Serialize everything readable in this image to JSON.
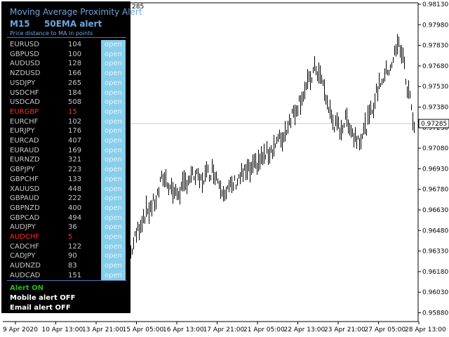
{
  "panel": {
    "title": "Moving Average Proximity Alert",
    "timeframe": "M15",
    "ma_label": "50EMA alert",
    "caption": "Price distance to MA in points",
    "rows": [
      {
        "symbol": "EURUSD",
        "distance": "104",
        "button": "open",
        "alert": false
      },
      {
        "symbol": "GBPUSD",
        "distance": "100",
        "button": "open",
        "alert": false
      },
      {
        "symbol": "AUDUSD",
        "distance": "128",
        "button": "open",
        "alert": false
      },
      {
        "symbol": "NZDUSD",
        "distance": "166",
        "button": "open",
        "alert": false
      },
      {
        "symbol": "USDJPY",
        "distance": "265",
        "button": "open",
        "alert": false
      },
      {
        "symbol": "USDCHF",
        "distance": "184",
        "button": "open",
        "alert": false
      },
      {
        "symbol": "USDCAD",
        "distance": "508",
        "button": "open",
        "alert": false
      },
      {
        "symbol": "EURGBP",
        "distance": "15",
        "button": "open",
        "alert": true
      },
      {
        "symbol": "EURCHF",
        "distance": "102",
        "button": "open",
        "alert": false
      },
      {
        "symbol": "EURJPY",
        "distance": "176",
        "button": "open",
        "alert": false
      },
      {
        "symbol": "EURCAD",
        "distance": "407",
        "button": "open",
        "alert": false
      },
      {
        "symbol": "EURAUD",
        "distance": "169",
        "button": "open",
        "alert": false
      },
      {
        "symbol": "EURNZD",
        "distance": "321",
        "button": "open",
        "alert": false
      },
      {
        "symbol": "GBPJPY",
        "distance": "223",
        "button": "open",
        "alert": false
      },
      {
        "symbol": "GBPCHF",
        "distance": "133",
        "button": "open",
        "alert": false
      },
      {
        "symbol": "XAUUSD",
        "distance": "448",
        "button": "open",
        "alert": false
      },
      {
        "symbol": "GBPAUD",
        "distance": "222",
        "button": "open",
        "alert": false
      },
      {
        "symbol": "GBPNZD",
        "distance": "400",
        "button": "open",
        "alert": false
      },
      {
        "symbol": "GBPCAD",
        "distance": "494",
        "button": "open",
        "alert": false
      },
      {
        "symbol": "AUDJPY",
        "distance": "36",
        "button": "open",
        "alert": false
      },
      {
        "symbol": "AUDCHF",
        "distance": "5",
        "button": "open",
        "alert": true
      },
      {
        "symbol": "CADCHF",
        "distance": "122",
        "button": "open",
        "alert": false
      },
      {
        "symbol": "CADJPY",
        "distance": "90",
        "button": "open",
        "alert": false
      },
      {
        "symbol": "AUDNZD",
        "distance": "83",
        "button": "open",
        "alert": false
      },
      {
        "symbol": "AUDCAD",
        "distance": "151",
        "button": "open",
        "alert": false
      }
    ],
    "alert_status": "Alert ON",
    "mobile_status": "Mobile alert OFF",
    "email_status": "Email alert OFF",
    "colors": {
      "alert_on": "#22bb22",
      "alert_row": "#ff2a2a",
      "button": "#87ceeb",
      "header": "#6ea6e0"
    }
  },
  "chart": {
    "top_left_value": "285",
    "current_price": "0.97285",
    "y_ticks": [
      "0.98130",
      "0.97980",
      "0.97830",
      "0.97680",
      "0.97530",
      "0.97380",
      "0.97230",
      "0.97080",
      "0.96930",
      "0.96780",
      "0.96630",
      "0.96480",
      "0.96330",
      "0.96180",
      "0.96030",
      "0.95880"
    ],
    "x_ticks": [
      "9 Apr 2020",
      "10 Apr 13:00",
      "13 Apr 21:00",
      "15 Apr 05:00",
      "16 Apr 13:00",
      "17 Apr 21:00",
      "21 Apr 05:00",
      "22 Apr 13:00",
      "23 Apr 21:00",
      "27 Apr 05:00",
      "28 Apr 13:00"
    ]
  },
  "chart_data": {
    "type": "bar",
    "title": "",
    "ylim": [
      0.958,
      0.982
    ],
    "close_points": [
      [
        0,
        0.9632
      ],
      [
        8,
        0.9648
      ],
      [
        16,
        0.966
      ],
      [
        24,
        0.9666
      ],
      [
        32,
        0.9672
      ],
      [
        40,
        0.969
      ],
      [
        48,
        0.9684
      ],
      [
        56,
        0.9676
      ],
      [
        64,
        0.968
      ],
      [
        72,
        0.9688
      ],
      [
        80,
        0.969
      ],
      [
        88,
        0.9686
      ],
      [
        96,
        0.9692
      ],
      [
        104,
        0.9695
      ],
      [
        112,
        0.9684
      ],
      [
        120,
        0.9678
      ],
      [
        128,
        0.9683
      ],
      [
        136,
        0.9689
      ],
      [
        144,
        0.9693
      ],
      [
        152,
        0.9694
      ],
      [
        160,
        0.9701
      ],
      [
        168,
        0.9705
      ],
      [
        176,
        0.971
      ],
      [
        184,
        0.9716
      ],
      [
        192,
        0.972
      ],
      [
        200,
        0.9734
      ],
      [
        208,
        0.9742
      ],
      [
        216,
        0.9752
      ],
      [
        224,
        0.9761
      ],
      [
        232,
        0.9772
      ],
      [
        240,
        0.9762
      ],
      [
        248,
        0.9742
      ],
      [
        256,
        0.9728
      ],
      [
        264,
        0.9726
      ],
      [
        272,
        0.9734
      ],
      [
        280,
        0.972
      ],
      [
        288,
        0.9719
      ],
      [
        296,
        0.9728
      ],
      [
        304,
        0.9742
      ],
      [
        312,
        0.976
      ],
      [
        320,
        0.9767
      ],
      [
        328,
        0.9776
      ],
      [
        336,
        0.979
      ],
      [
        342,
        0.9782
      ],
      [
        346,
        0.9758
      ],
      [
        350,
        0.9752
      ],
      [
        356,
        0.9729
      ]
    ]
  }
}
